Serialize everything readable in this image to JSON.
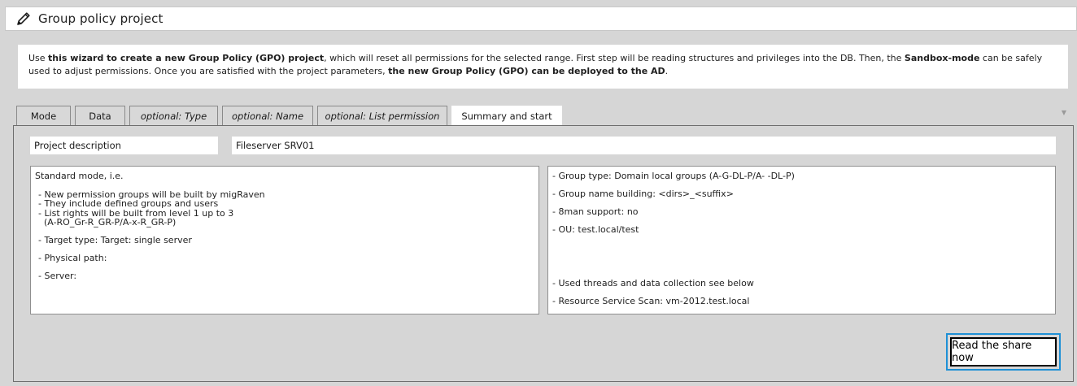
{
  "window": {
    "title": "Group policy project"
  },
  "info": {
    "segments": [
      {
        "text": "Use ",
        "bold": false
      },
      {
        "text": "this wizard to create a new Group Policy (GPO) project",
        "bold": true
      },
      {
        "text": ", which will reset all permissions for the selected range. First step will be reading structures and privileges into the DB. Then, the ",
        "bold": false
      },
      {
        "text": "Sandbox-mode",
        "bold": true
      },
      {
        "text": " can be safely used to adjust permissions. Once you are satisfied with the project parameters, ",
        "bold": false
      },
      {
        "text": "the new Group Policy (GPO) can be deployed to the AD",
        "bold": true
      },
      {
        "text": ".",
        "bold": false
      }
    ]
  },
  "tabs": [
    {
      "label": "Mode",
      "italic": false,
      "active": false
    },
    {
      "label": "Data",
      "italic": false,
      "active": false
    },
    {
      "label": "optional: Type",
      "italic": true,
      "active": false
    },
    {
      "label": "optional: Name",
      "italic": true,
      "active": false
    },
    {
      "label": "optional: List permission",
      "italic": true,
      "active": false
    },
    {
      "label": "Summary and start",
      "italic": false,
      "active": true
    }
  ],
  "collapse_glyph": "▼",
  "project": {
    "description_label": "Project description",
    "description_value": "Fileserver SRV01"
  },
  "summary_left": {
    "heading": "Standard mode, i.e.",
    "bullets": [
      "- New permission groups will be built by migRaven",
      "- They include defined groups and users",
      "- List rights will be built from level 1 up to 3"
    ],
    "bullet_cont": "(A-RO_Gr-R_GR-P/A-x-R_GR-P)",
    "target_type": "- Target type: Target: single server",
    "physical_path": "- Physical path:",
    "server": "- Server:"
  },
  "summary_right": {
    "group_type": "- Group type: Domain local groups (A-G-DL-P/A- -DL-P)",
    "group_name": "- Group name building: <dirs>_<suffix>",
    "support_8man": "- 8man support: no",
    "ou": "- OU: test.local/test",
    "threads": "- Used threads and data collection see below",
    "resource_scan": "- Resource Service Scan: vm-2012.test.local"
  },
  "actions": {
    "read_share_label": "Read the share now"
  },
  "colors": {
    "focus_border": "#1e90d6",
    "background": "#d6d6d6"
  }
}
